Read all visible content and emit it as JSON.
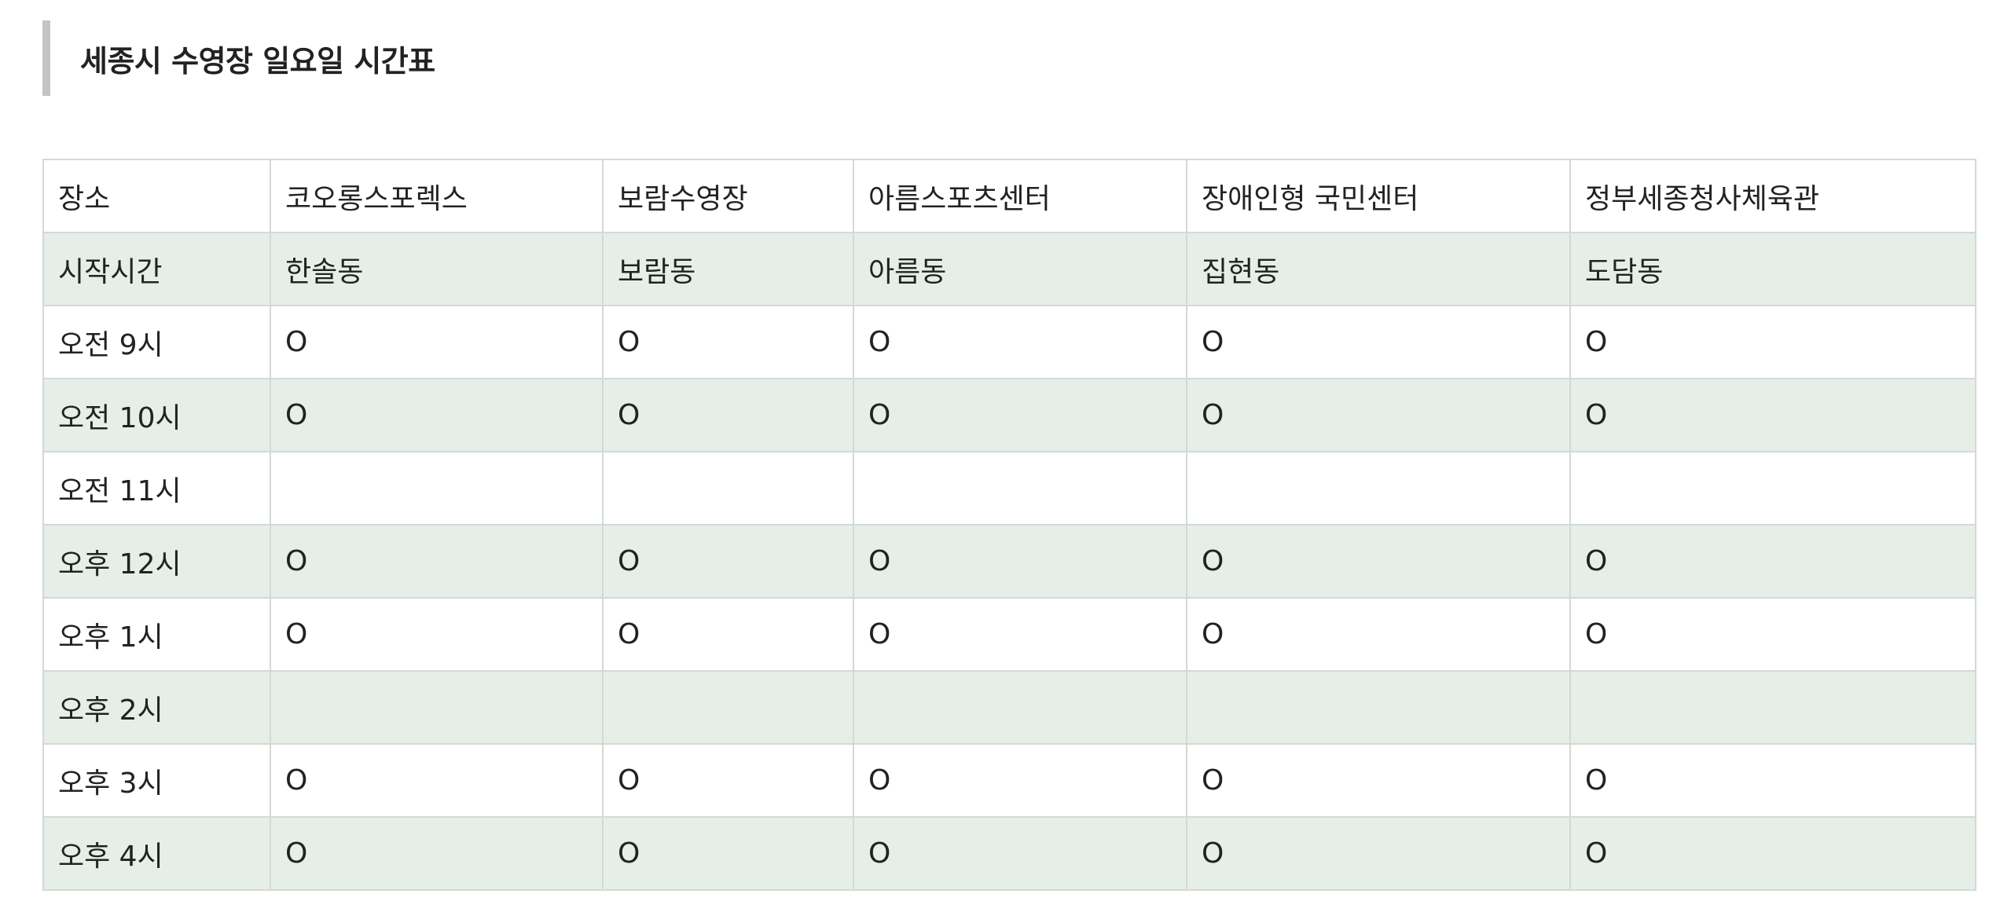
{
  "title": "세종시 수영장 일요일 시간표",
  "table": {
    "header": [
      "장소",
      "코오롱스포렉스",
      "보람수영장",
      "아름스포츠센터",
      "장애인형 국민센터",
      "정부세종청사체육관"
    ],
    "subheader": [
      "시작시간",
      "한솔동",
      "보람동",
      "아름동",
      "집현동",
      "도담동"
    ],
    "rows": [
      [
        "오전 9시",
        "O",
        "O",
        "O",
        "O",
        "O"
      ],
      [
        "오전 10시",
        "O",
        "O",
        "O",
        "O",
        "O"
      ],
      [
        "오전 11시",
        "",
        "",
        "",
        "",
        ""
      ],
      [
        "오후 12시",
        "O",
        "O",
        "O",
        "O",
        "O"
      ],
      [
        "오후 1시",
        "O",
        "O",
        "O",
        "O",
        "O"
      ],
      [
        "오후 2시",
        "",
        "",
        "",
        "",
        ""
      ],
      [
        "오후 3시",
        "O",
        "O",
        "O",
        "O",
        "O"
      ],
      [
        "오후 4시",
        "O",
        "O",
        "O",
        "O",
        "O"
      ]
    ]
  }
}
